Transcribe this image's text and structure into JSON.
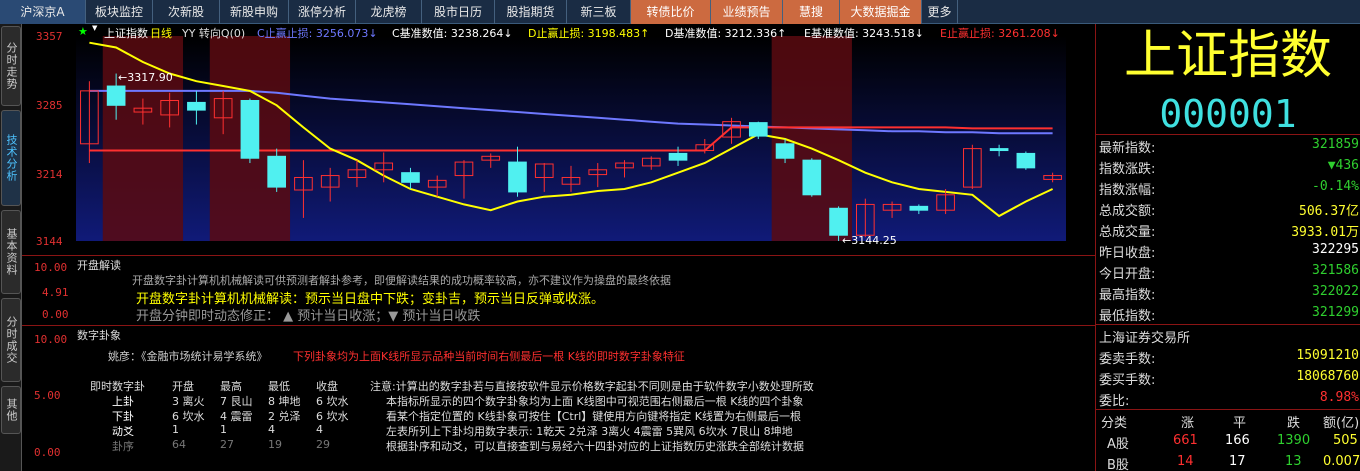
{
  "nav": {
    "tabs": [
      "沪深京A",
      "板块监控",
      "次新股",
      "新股申购",
      "涨停分析",
      "龙虎榜",
      "股市日历",
      "股指期货",
      "新三板",
      "转债比价",
      "业绩预告",
      "慧搜",
      "大数据掘金",
      "更多"
    ]
  },
  "sidebar": {
    "tabs": [
      "分时走势",
      "技术分析",
      "基本资料",
      "分时成交",
      "其他"
    ]
  },
  "chart": {
    "title": "上证指数",
    "period": "日线",
    "mode": "YY 转向Q(0)",
    "legend": [
      {
        "text": "C止赢止损: 3256.073↓",
        "color": "#6e78ff"
      },
      {
        "text": "C基准数值: 3238.264↓",
        "color": "#ffffff"
      },
      {
        "text": "D止赢止损: 3198.483↑",
        "color": "#ffff00"
      },
      {
        "text": "D基准数值: 3212.336↑",
        "color": "#ffffff"
      },
      {
        "text": "E基准数值: 3243.518↓",
        "color": "#ffffff"
      },
      {
        "text": "E止赢止损: 3261.208↓",
        "color": "#ff3030"
      }
    ],
    "y_ticks": [
      "3357",
      "3285",
      "3214",
      "3144"
    ],
    "high_label": "3317.90",
    "low_label": "3144.25"
  },
  "chart_data": {
    "type": "candlestick",
    "ylim": [
      3144,
      3357
    ],
    "candles": [
      {
        "o": 3245,
        "c": 3300,
        "h": 3310,
        "l": 3225,
        "up": true
      },
      {
        "o": 3305,
        "c": 3285,
        "h": 3318,
        "l": 3270,
        "up": false
      },
      {
        "o": 3282,
        "c": 3278,
        "h": 3292,
        "l": 3265,
        "up": true
      },
      {
        "o": 3275,
        "c": 3290,
        "h": 3298,
        "l": 3262,
        "up": true
      },
      {
        "o": 3288,
        "c": 3280,
        "h": 3300,
        "l": 3265,
        "up": false
      },
      {
        "o": 3272,
        "c": 3292,
        "h": 3300,
        "l": 3255,
        "up": true
      },
      {
        "o": 3290,
        "c": 3230,
        "h": 3292,
        "l": 3225,
        "up": false
      },
      {
        "o": 3232,
        "c": 3200,
        "h": 3240,
        "l": 3195,
        "up": false
      },
      {
        "o": 3197,
        "c": 3210,
        "h": 3228,
        "l": 3168,
        "up": true
      },
      {
        "o": 3200,
        "c": 3212,
        "h": 3220,
        "l": 3185,
        "up": true
      },
      {
        "o": 3210,
        "c": 3218,
        "h": 3228,
        "l": 3200,
        "up": true
      },
      {
        "o": 3218,
        "c": 3225,
        "h": 3236,
        "l": 3205,
        "up": true
      },
      {
        "o": 3215,
        "c": 3205,
        "h": 3220,
        "l": 3198,
        "up": false
      },
      {
        "o": 3200,
        "c": 3207,
        "h": 3212,
        "l": 3190,
        "up": true
      },
      {
        "o": 3212,
        "c": 3226,
        "h": 3228,
        "l": 3188,
        "up": true
      },
      {
        "o": 3228,
        "c": 3232,
        "h": 3235,
        "l": 3220,
        "up": true
      },
      {
        "o": 3226,
        "c": 3195,
        "h": 3242,
        "l": 3190,
        "up": false
      },
      {
        "o": 3210,
        "c": 3224,
        "h": 3225,
        "l": 3195,
        "up": true
      },
      {
        "o": 3203,
        "c": 3210,
        "h": 3222,
        "l": 3195,
        "up": true
      },
      {
        "o": 3213,
        "c": 3218,
        "h": 3225,
        "l": 3200,
        "up": true
      },
      {
        "o": 3220,
        "c": 3225,
        "h": 3228,
        "l": 3210,
        "up": true
      },
      {
        "o": 3222,
        "c": 3230,
        "h": 3232,
        "l": 3218,
        "up": true
      },
      {
        "o": 3235,
        "c": 3228,
        "h": 3242,
        "l": 3222,
        "up": false
      },
      {
        "o": 3238,
        "c": 3244,
        "h": 3250,
        "l": 3235,
        "up": true
      },
      {
        "o": 3252,
        "c": 3268,
        "h": 3272,
        "l": 3245,
        "up": true
      },
      {
        "o": 3267,
        "c": 3253,
        "h": 3268,
        "l": 3250,
        "up": false
      },
      {
        "o": 3245,
        "c": 3230,
        "h": 3250,
        "l": 3225,
        "up": false
      },
      {
        "o": 3228,
        "c": 3192,
        "h": 3230,
        "l": 3190,
        "up": false
      },
      {
        "o": 3178,
        "c": 3150,
        "h": 3180,
        "l": 3144,
        "up": false
      },
      {
        "o": 3150,
        "c": 3182,
        "h": 3188,
        "l": 3148,
        "up": true
      },
      {
        "o": 3176,
        "c": 3182,
        "h": 3185,
        "l": 3168,
        "up": true
      },
      {
        "o": 3180,
        "c": 3176,
        "h": 3182,
        "l": 3172,
        "up": false
      },
      {
        "o": 3176,
        "c": 3192,
        "h": 3198,
        "l": 3172,
        "up": true
      },
      {
        "o": 3200,
        "c": 3240,
        "h": 3244,
        "l": 3198,
        "up": true
      },
      {
        "o": 3240,
        "c": 3238,
        "h": 3244,
        "l": 3232,
        "up": false
      },
      {
        "o": 3235,
        "c": 3220,
        "h": 3237,
        "l": 3218,
        "up": false
      },
      {
        "o": 3208,
        "c": 3212,
        "h": 3215,
        "l": 3205,
        "up": true
      }
    ],
    "shaded": [
      [
        1,
        3
      ],
      [
        5,
        7
      ],
      [
        26,
        28
      ]
    ],
    "series": [
      {
        "name": "C",
        "color": "#6e78ff",
        "values": [
          3300,
          3300,
          3300,
          3300,
          3300,
          3300,
          3300,
          3298,
          3295,
          3292,
          3290,
          3288,
          3286,
          3284,
          3282,
          3280,
          3278,
          3276,
          3274,
          3272,
          3270,
          3268,
          3266,
          3265,
          3264,
          3263,
          3262,
          3261,
          3260,
          3259,
          3258,
          3258,
          3257,
          3257,
          3256,
          3256,
          3256
        ]
      },
      {
        "name": "E",
        "color": "#ff3030",
        "values": [
          3238,
          3238,
          3238,
          3238,
          3238,
          3238,
          3238,
          3238,
          3238,
          3238,
          3238,
          3238,
          3238,
          3238,
          3238,
          3238,
          3238,
          3238,
          3238,
          3238,
          3238,
          3238,
          3238,
          3238,
          3262,
          3262,
          3262,
          3262,
          3262,
          3262,
          3262,
          3262,
          3262,
          3261,
          3261,
          3261,
          3261
        ]
      },
      {
        "name": "D",
        "color": "#ffff00",
        "values": [
          3350,
          3345,
          3330,
          3318,
          3310,
          3305,
          3300,
          3285,
          3262,
          3240,
          3228,
          3212,
          3198,
          3190,
          3182,
          3176,
          3185,
          3190,
          3192,
          3196,
          3198,
          3205,
          3215,
          3225,
          3240,
          3255,
          3250,
          3240,
          3228,
          3215,
          3205,
          3198,
          3195,
          3192,
          3170,
          3185,
          3198
        ]
      }
    ]
  },
  "indicator": {
    "title": "开盘解读",
    "y_ticks": [
      "10.00",
      "4.91",
      "0.00"
    ],
    "line1": "开盘数字卦计算机机械解读可供预测者解卦参考，即便解读结果的成功概率较高，亦不建议作为操盘的最终依据",
    "line2": "开盘数字卦计算机机械解读：预示当日盘中下跌；变卦吉，预示当日反弹或收涨。",
    "line3": "开盘分钟即时动态修正：  ▲ 预计当日收涨；▼ 预计当日收跌"
  },
  "gua": {
    "title": "数字卦象",
    "y_ticks": [
      "10.00",
      "5.00",
      "0.00"
    ],
    "author": "姚彦：《金融市场统计易学系统》",
    "subtitle": "下列卦象均为上面K线所显示品种当前时间右侧最后一根 K线的即时数字卦象特征",
    "headers": [
      "即时数字卦",
      "开盘",
      "最高",
      "最低",
      "收盘"
    ],
    "rows": [
      [
        "上卦",
        "3 离火",
        "7 艮山",
        "8 坤地",
        "6 坎水"
      ],
      [
        "下卦",
        "6 坎水",
        "4 震雷",
        "2 兑泽",
        "6 坎水"
      ],
      [
        "动爻",
        "1",
        "1",
        "4",
        "4"
      ],
      [
        "卦序",
        "64",
        "27",
        "19",
        "29"
      ]
    ],
    "note": [
      "注意:计算出的数字卦若与直接按软件显示价格数字起卦不同则是由于软件数字小数处理所致",
      "本指标所显示的四个数字卦象均为上面 K线图中可视范围右侧最后一根 K线的四个卦象",
      "看某个指定位置的 K线卦象可按住【Ctrl】键使用方向键将指定 K线置为右侧最后一根",
      "左表所列上下卦均用数字表示: 1乾天 2兑泽 3离火 4震雷 5巽风 6坎水 7艮山 8坤地",
      "根据卦序和动爻，可以直接查到与易经六十四卦对应的上证指数历史涨跌全部统计数据"
    ]
  },
  "quote": {
    "name": "上证指数",
    "code": "000001",
    "rows": [
      {
        "k": "最新指数:",
        "v": "321859"
      },
      {
        "k": "指数涨跌:",
        "v": "▼436"
      },
      {
        "k": "指数涨幅:",
        "v": "-0.14%"
      },
      {
        "k": "总成交额:",
        "v": "506.37亿"
      },
      {
        "k": "总成交量:",
        "v": "3933.01万"
      },
      {
        "k": "昨日收盘:",
        "v": "322295"
      },
      {
        "k": "今日开盘:",
        "v": "321586"
      },
      {
        "k": "最高指数:",
        "v": "322022"
      },
      {
        "k": "最低指数:",
        "v": "321299"
      }
    ],
    "exchange": "上海证券交易所",
    "rows2": [
      {
        "k": "委卖手数:",
        "v": "15091210"
      },
      {
        "k": "委买手数:",
        "v": "18068760"
      },
      {
        "k": "委比:",
        "v": "8.98%"
      }
    ],
    "table_headers": [
      "分类",
      "涨",
      "平",
      "跌",
      "额(亿)"
    ],
    "table_rows": [
      [
        "A股",
        "661",
        "166",
        "1390",
        "505"
      ],
      [
        "B股",
        "14",
        "17",
        "13",
        "0.007"
      ]
    ]
  }
}
